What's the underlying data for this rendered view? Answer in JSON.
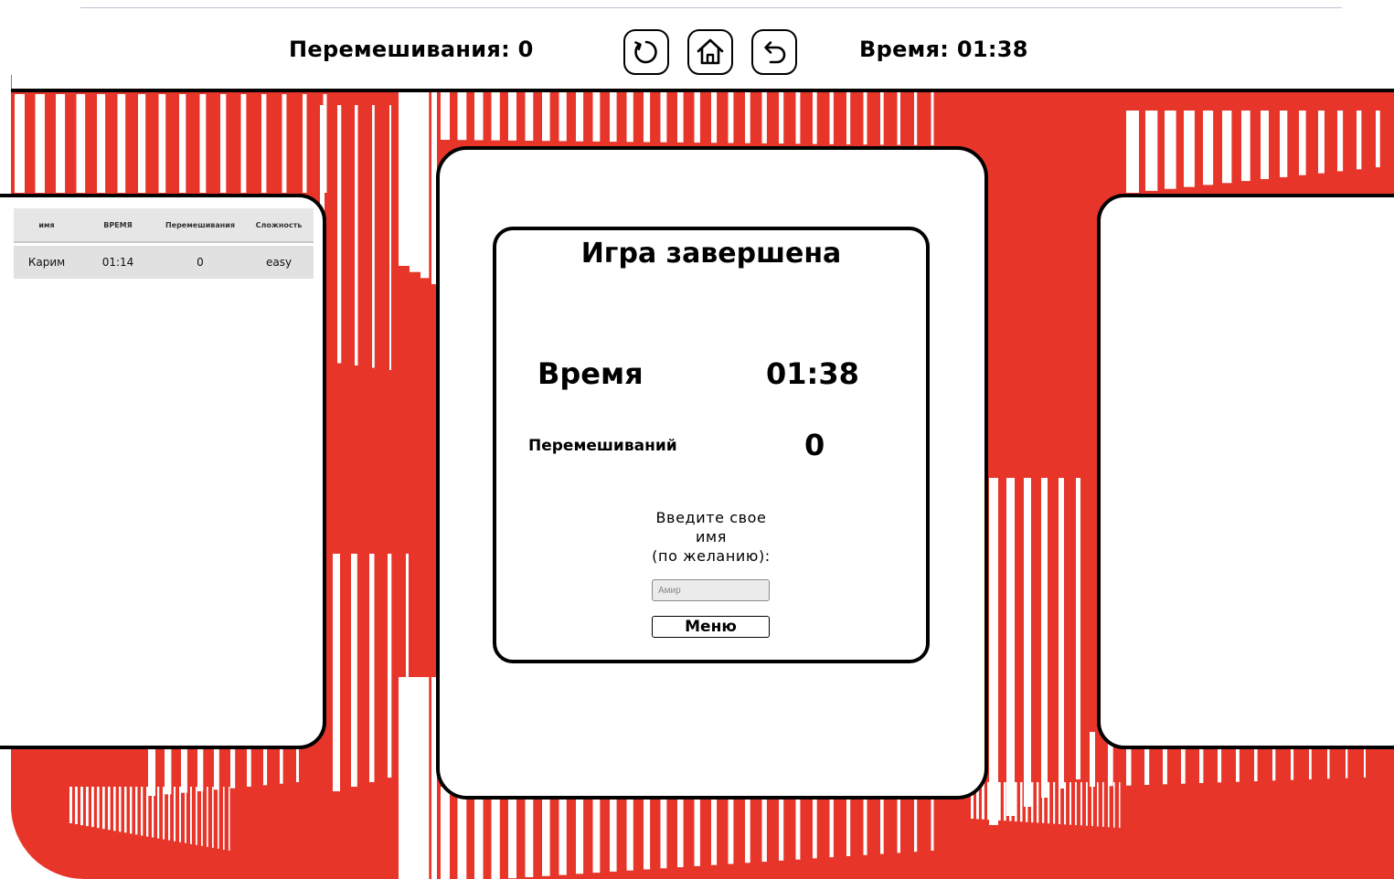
{
  "header": {
    "shuffles_text": "Перемешивания: 0",
    "time_text": "Время: 01:38",
    "buttons": [
      {
        "name": "restart",
        "icon": "restart-icon"
      },
      {
        "name": "home",
        "icon": "home-icon"
      },
      {
        "name": "back",
        "icon": "undo-arrow-icon"
      }
    ]
  },
  "leaderboard": {
    "columns": [
      "имя",
      "ВРЕМЯ",
      "Перемешивания",
      "Сложность"
    ],
    "rows": [
      {
        "name": "Карим",
        "time": "01:14",
        "shuffles": "0",
        "difficulty": "easy"
      }
    ]
  },
  "result": {
    "title": "Игра завершена",
    "time_label": "Время",
    "time_value": "01:38",
    "shuffles_label": "Перемешиваний",
    "shuffles_value": "0",
    "prompt_line1": "Введите свое",
    "prompt_line2": "имя",
    "prompt_line3": "(по желанию):",
    "name_placeholder": "Амир",
    "menu_button": "Меню"
  },
  "colors": {
    "accent_red": "#e8352a",
    "stripe": "#ffffff",
    "outline": "#000000"
  }
}
